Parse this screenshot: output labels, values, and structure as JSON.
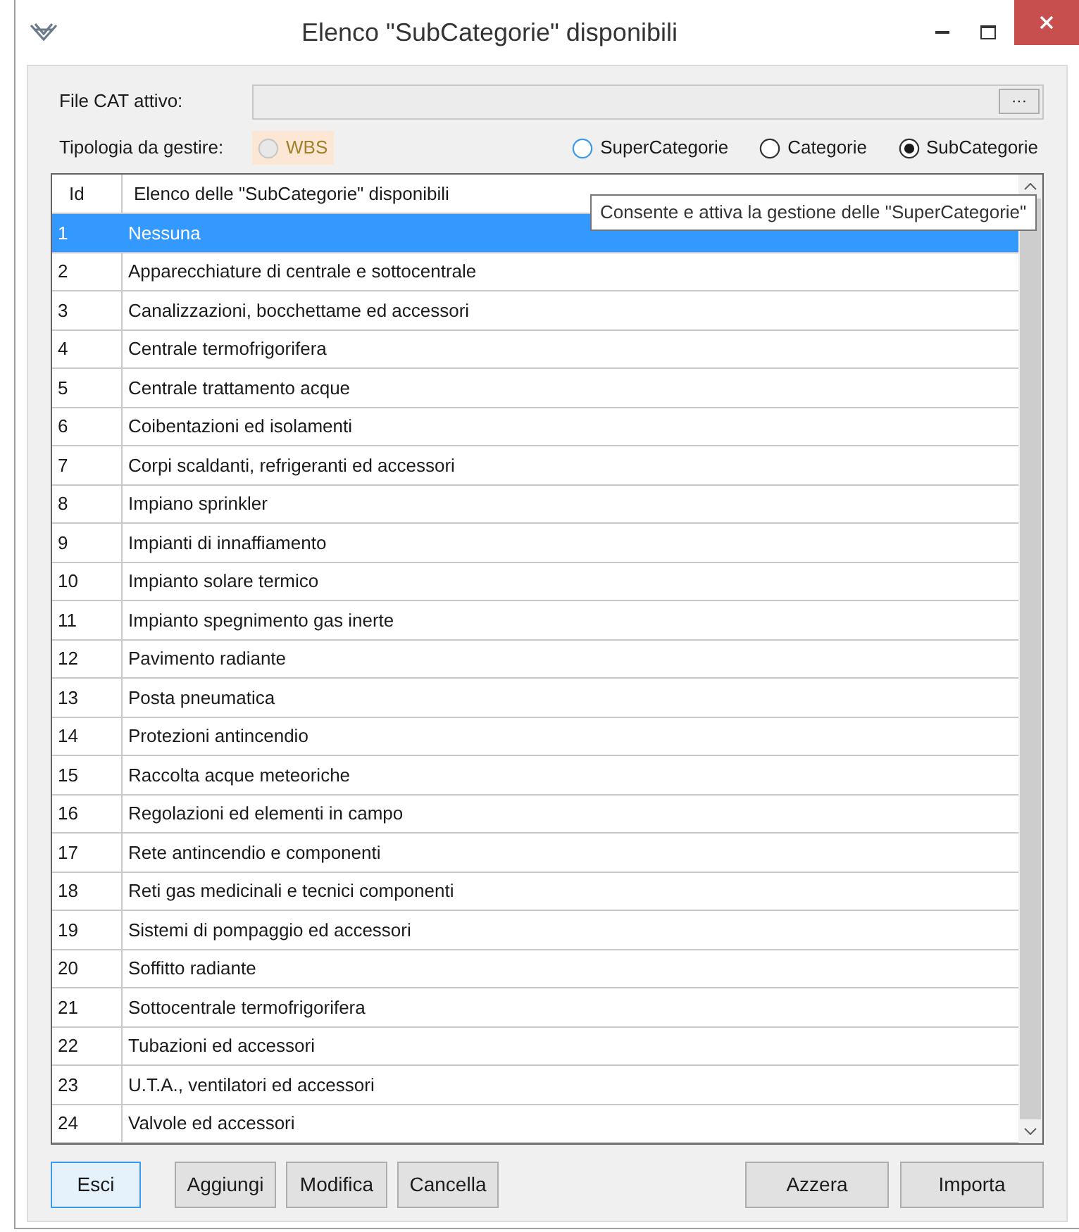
{
  "window": {
    "title": "Elenco \"SubCategorie\" disponibili"
  },
  "file_field": {
    "label": "File CAT attivo:",
    "browse_button": "···"
  },
  "type_group": {
    "label": "Tipologia da gestire:",
    "options": [
      {
        "label": "WBS",
        "selected": false,
        "disabled": true,
        "hovered": false
      },
      {
        "label": "SuperCategorie",
        "selected": false,
        "disabled": false,
        "hovered": true
      },
      {
        "label": "Categorie",
        "selected": false,
        "disabled": false,
        "hovered": false
      },
      {
        "label": "SubCategorie",
        "selected": true,
        "disabled": false,
        "hovered": false
      }
    ]
  },
  "tooltip": "Consente e attiva la gestione delle \"SuperCategorie\"",
  "table": {
    "columns": [
      "Id",
      "Elenco delle \"SubCategorie\" disponibili"
    ],
    "rows": [
      {
        "id": "1",
        "name": "Nessuna",
        "selected": true
      },
      {
        "id": "2",
        "name": "Apparecchiature di centrale e sottocentrale",
        "selected": false
      },
      {
        "id": "3",
        "name": "Canalizzazioni, bocchettame ed accessori",
        "selected": false
      },
      {
        "id": "4",
        "name": "Centrale termofrigorifera",
        "selected": false
      },
      {
        "id": "5",
        "name": "Centrale trattamento acque",
        "selected": false
      },
      {
        "id": "6",
        "name": "Coibentazioni ed isolamenti",
        "selected": false
      },
      {
        "id": "7",
        "name": "Corpi scaldanti, refrigeranti ed accessori",
        "selected": false
      },
      {
        "id": "8",
        "name": "Impiano sprinkler",
        "selected": false
      },
      {
        "id": "9",
        "name": "Impianti di innaffiamento",
        "selected": false
      },
      {
        "id": "10",
        "name": "Impianto solare termico",
        "selected": false
      },
      {
        "id": "11",
        "name": "Impianto spegnimento gas inerte",
        "selected": false
      },
      {
        "id": "12",
        "name": "Pavimento radiante",
        "selected": false
      },
      {
        "id": "13",
        "name": "Posta pneumatica",
        "selected": false
      },
      {
        "id": "14",
        "name": "Protezioni antincendio",
        "selected": false
      },
      {
        "id": "15",
        "name": "Raccolta acque meteoriche",
        "selected": false
      },
      {
        "id": "16",
        "name": "Regolazioni ed elementi in campo",
        "selected": false
      },
      {
        "id": "17",
        "name": "Rete antincendio e componenti",
        "selected": false
      },
      {
        "id": "18",
        "name": "Reti gas medicinali e tecnici componenti",
        "selected": false
      },
      {
        "id": "19",
        "name": "Sistemi di pompaggio ed accessori",
        "selected": false
      },
      {
        "id": "20",
        "name": "Soffitto radiante",
        "selected": false
      },
      {
        "id": "21",
        "name": "Sottocentrale termofrigorifera",
        "selected": false
      },
      {
        "id": "22",
        "name": "Tubazioni ed accessori",
        "selected": false
      },
      {
        "id": "23",
        "name": "U.T.A., ventilatori ed accessori",
        "selected": false
      },
      {
        "id": "24",
        "name": "Valvole ed accessori",
        "selected": false
      }
    ]
  },
  "buttons_left": [
    {
      "label": "Esci",
      "default": true
    },
    {
      "label": "Aggiungi",
      "default": false
    },
    {
      "label": "Modifica",
      "default": false
    },
    {
      "label": "Cancella",
      "default": false
    }
  ],
  "buttons_right": [
    {
      "label": "Azzera",
      "default": false
    },
    {
      "label": "Importa",
      "default": false
    }
  ]
}
